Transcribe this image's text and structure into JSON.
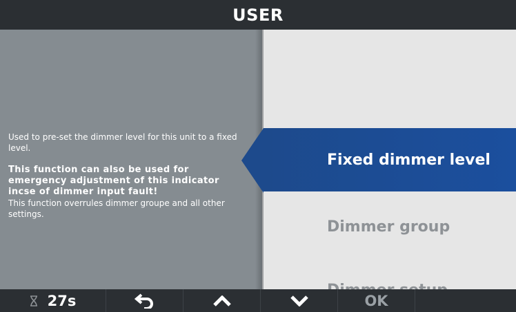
{
  "header": {
    "title": "USER"
  },
  "description": {
    "line1": "Used to pre-set the dimmer level for this unit to a fixed level.",
    "bold": "This function can also be used for emergency adjustment of this indicator incse of dimmer input fault!",
    "line2": "This function overrules dimmer groupe and all other settings."
  },
  "menu": {
    "items": [
      {
        "label": "Fixed dimmer level",
        "selected": true
      },
      {
        "label": "Dimmer group",
        "selected": false
      },
      {
        "label": "Dimmer setup",
        "selected": false
      }
    ]
  },
  "bottom_bar": {
    "timer_icon": "hourglass-icon",
    "timer_value": "27s",
    "back_icon": "back-arrow-icon",
    "up_icon": "chevron-up-icon",
    "down_icon": "chevron-down-icon",
    "ok_label": "OK"
  },
  "colors": {
    "title_bar": "#2b2f33",
    "left_panel": "#858c91",
    "selected_item": "#1d4a8c",
    "menu_background": "#e6e6e6",
    "inactive_text": "#8e9296"
  }
}
